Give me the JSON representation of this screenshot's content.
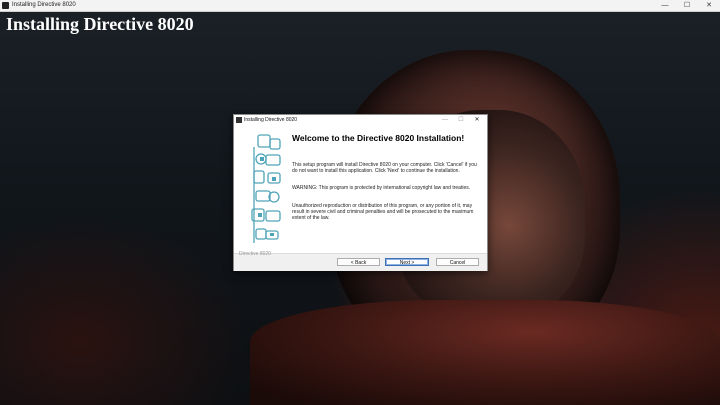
{
  "window": {
    "title": "Installing Directive 8020",
    "controls": {
      "minimize": "—",
      "maximize": "☐",
      "close": "✕"
    }
  },
  "background": {
    "heading": "Installing Directive 8020"
  },
  "dialog": {
    "title": "Installing Directive 8020",
    "controls": {
      "minimize": "—",
      "maximize": "☐",
      "close": "✕"
    },
    "heading": "Welcome to the Directive 8020 Installation!",
    "paragraphs": [
      "This setup program will install Directive 8020 on your computer. Click 'Cancel' if you do not want to install this application. Click 'Next' to continue the installation.",
      "WARNING: This program is protected by international copyright law and treaties.",
      "Unauthorized reproduction or distribution of this program, or any portion of it, may result in severe civil and criminal penalties and will be prosecuted to the maximum extent of the law."
    ],
    "brand": "Directive 8020",
    "buttons": {
      "back": "< Back",
      "next": "Next >",
      "cancel": "Cancel"
    },
    "accent_color": "#4fa3b8"
  }
}
